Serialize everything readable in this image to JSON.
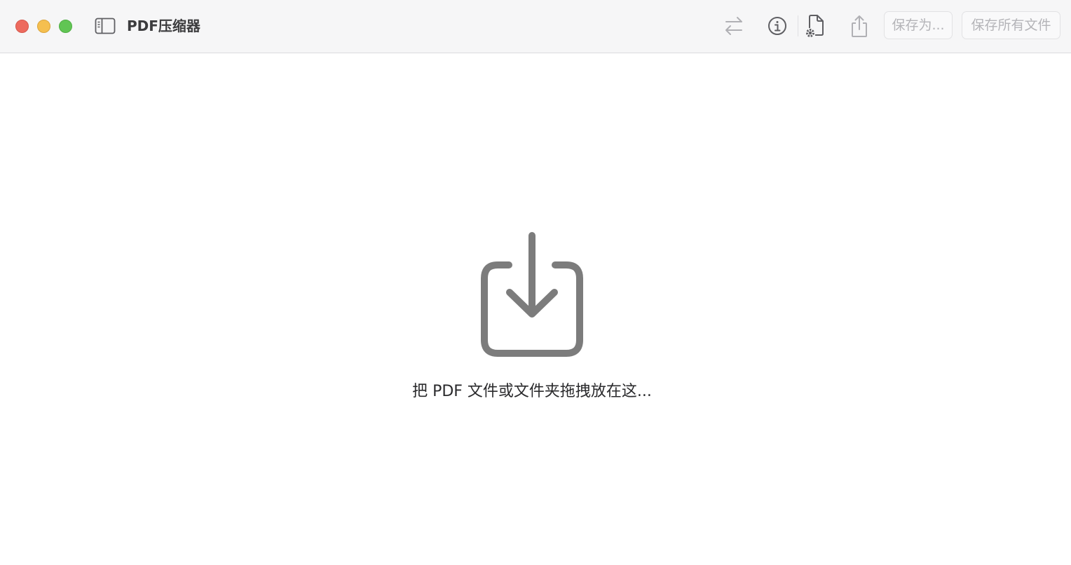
{
  "window": {
    "title": "PDF压缩器",
    "traffic_lights": [
      "close-button",
      "minimize-button",
      "zoom-button"
    ],
    "colors": {
      "close": "#ed6a5e",
      "minimize": "#f5bf4f",
      "zoom": "#61c554"
    }
  },
  "toolbar": {
    "icons": [
      "sidebar-toggle-icon",
      "swap-arrows-icon",
      "info-icon",
      "document-settings-icon",
      "share-icon"
    ],
    "save_as_label": "保存为...",
    "save_all_label": "保存所有文件",
    "buttons_enabled": false
  },
  "drop_zone": {
    "icon": "tray-download-icon",
    "hint": "把 PDF 文件或文件夹拖拽放在这..."
  }
}
